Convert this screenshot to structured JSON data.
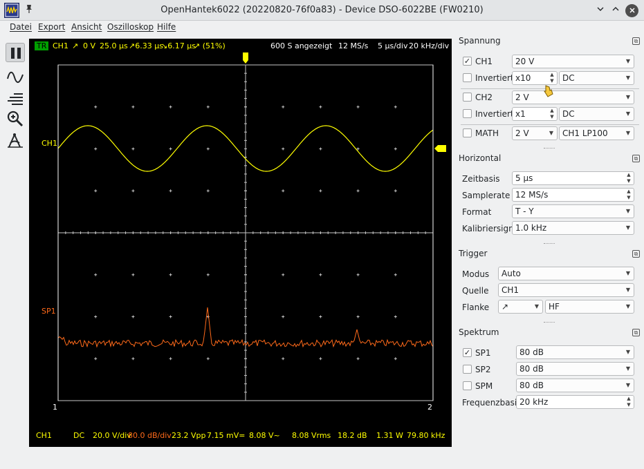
{
  "window": {
    "title": "OpenHantek6022 (20220820-76f0a83) - Device DSO-6022BE (FW0210)",
    "icons": [
      "app-icon",
      "pin-icon",
      "minimize-icon",
      "maximize-icon",
      "close-icon"
    ]
  },
  "menu": [
    "Datei",
    "Export",
    "Ansicht",
    "Oszilloskop",
    "Hilfe"
  ],
  "toolbar": [
    "pause-icon",
    "waveform-icon",
    "lines-icon",
    "zoom-icon",
    "measure-icon"
  ],
  "scope": {
    "trigger_badge": "TR",
    "top_channel": "CH1",
    "top_slope": "↗",
    "top_level": "0 V",
    "top_pos": "25.0 µs",
    "top_rise": "↗6.33 µs",
    "top_fall": "↘6.17 µs",
    "top_duty": "↗ (51%)",
    "samples": "600 S angezeigt",
    "rate": "12 MS/s",
    "timebase": "5 µs/div",
    "freqbase": "20 kHz/div",
    "ch1_marker": "CH1",
    "sp1_marker": "SP1",
    "cursor_left": "1",
    "cursor_right": "2",
    "colors": {
      "ch1": "#ffff00",
      "sp1": "#ff6a1a",
      "grid": "#c8c8c8",
      "bg": "#000000"
    }
  },
  "bottom": {
    "ch": "CH1",
    "coupling": "DC",
    "vdiv": "20.0 V/div",
    "dbdiv": "80.0 dB/div",
    "vpp": "23.2 Vpp",
    "vdc": "7.15 mV=",
    "vac": "8.08 V~",
    "vrms": "8.08 Vrms",
    "db": "18.2 dB",
    "watt": "1.31 W",
    "freq": "79.80 kHz"
  },
  "spannung": {
    "title": "Spannung",
    "ch1": {
      "label": "CH1",
      "checked": "✓",
      "volt": "20 V"
    },
    "inv1": {
      "label": "Invertiert",
      "probe": "x10",
      "coupling": "DC"
    },
    "ch2": {
      "label": "CH2",
      "volt": "2 V"
    },
    "inv2": {
      "label": "Invertiert",
      "probe": "x1",
      "coupling": "DC"
    },
    "math": {
      "label": "MATH",
      "volt": "2 V",
      "mode": "CH1 LP100"
    }
  },
  "horizontal": {
    "title": "Horizontal",
    "zeitbasis_label": "Zeitbasis",
    "zeitbasis": "5 µs",
    "samplerate_label": "Samplerate",
    "samplerate": "12 MS/s",
    "format_label": "Format",
    "format": "T - Y",
    "kal_label": "Kalibriersignal",
    "kal": "1.0 kHz"
  },
  "trigger": {
    "title": "Trigger",
    "modus_label": "Modus",
    "modus": "Auto",
    "quelle_label": "Quelle",
    "quelle": "CH1",
    "flanke_label": "Flanke",
    "flanke": "↗",
    "filter": "HF"
  },
  "spektrum": {
    "title": "Spektrum",
    "sp1": {
      "label": "SP1",
      "checked": "✓",
      "db": "80 dB"
    },
    "sp2": {
      "label": "SP2",
      "db": "80 dB"
    },
    "spm": {
      "label": "SPM",
      "db": "80 dB"
    },
    "freq_label": "Frequenzbasis",
    "freq": "20 kHz"
  }
}
